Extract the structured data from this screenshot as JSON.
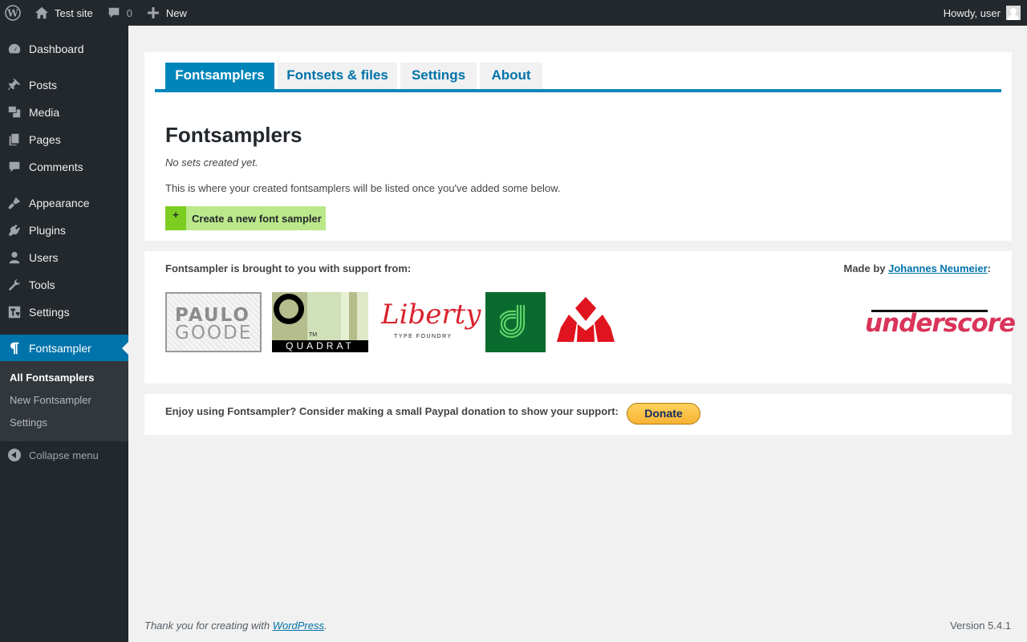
{
  "adminbar": {
    "site_name": "Test site",
    "comments_count": "0",
    "new_label": "New",
    "greeting": "Howdy, user"
  },
  "sidebar": {
    "items": [
      {
        "label": "Dashboard",
        "icon": "dashboard-icon"
      },
      {
        "label": "Posts",
        "icon": "pin-icon"
      },
      {
        "label": "Media",
        "icon": "media-icon"
      },
      {
        "label": "Pages",
        "icon": "pages-icon"
      },
      {
        "label": "Comments",
        "icon": "comment-icon"
      },
      {
        "label": "Appearance",
        "icon": "brush-icon"
      },
      {
        "label": "Plugins",
        "icon": "plug-icon"
      },
      {
        "label": "Users",
        "icon": "user-icon"
      },
      {
        "label": "Tools",
        "icon": "wrench-icon"
      },
      {
        "label": "Settings",
        "icon": "settings-icon"
      },
      {
        "label": "Fontsampler",
        "icon": "pilcrow-icon"
      }
    ],
    "submenu": [
      "All Fontsamplers",
      "New Fontsampler",
      "Settings"
    ],
    "collapse_label": "Collapse menu"
  },
  "tabs": [
    "Fontsamplers",
    "Fontsets & files",
    "Settings",
    "About"
  ],
  "main": {
    "title": "Fontsamplers",
    "empty_note": "No sets created yet.",
    "help_text": "This is where your created fontsamplers will be listed once you've added some below.",
    "create_plus": "+",
    "create_label": "Create a new font sampler"
  },
  "sponsors": {
    "text": "Fontsampler is brought to you with support from:",
    "made_by_prefix": "Made by ",
    "author": "Johannes Neumeier",
    "made_by_suffix": ":",
    "logos": {
      "paulo_line1": "PAULO",
      "paulo_line2": "GOODE",
      "quadrat": "QUADRAT",
      "quadrat_tm": "TM",
      "liberty": "Liberty",
      "liberty_sub": "TYPE FOUNDRY",
      "underscore": "underscore"
    }
  },
  "donate": {
    "text": "Enjoy using Fontsampler? Consider making a small Paypal donation to show your support:",
    "button": "Donate"
  },
  "footer": {
    "thanks_prefix": "Thank you for creating with ",
    "wordpress_link": "WordPress",
    "thanks_suffix": ".",
    "version": "Version 5.4.1"
  },
  "colors": {
    "accent": "#0073aa",
    "admin_dark": "#23282d",
    "create_button": "#bbe88a"
  }
}
